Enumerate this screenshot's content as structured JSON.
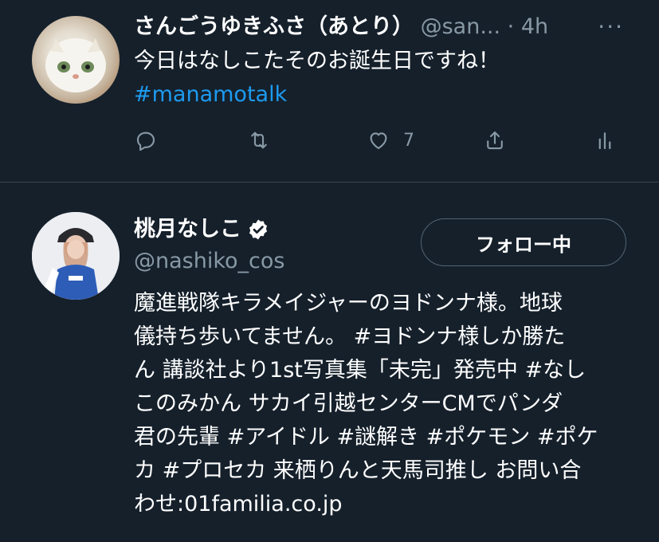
{
  "tweet": {
    "display_name": "さんごうゆきふさ（あとり）",
    "handle": "@san...",
    "time": "· 4h",
    "more": "···",
    "text_line1": "今日はなしこたそのお誕生日ですね！",
    "hashtag": "#manamotalk",
    "like_count": "7",
    "icons": [
      "reply-icon",
      "retweet-icon",
      "like-icon",
      "share-icon",
      "analytics-icon"
    ]
  },
  "profile": {
    "display_name": "桃月なしこ",
    "handle": "@nashiko_cos",
    "follow_label": "フォロー中",
    "bio_lines": [
      "魔進戦隊キラメイジャーのヨドンナ様。地球",
      "儀持ち歩いてません。 #ヨドンナ様しか勝た",
      "ん 講談社より1st写真集「未完」発売中 #なし",
      "このみかん サカイ引越センターCMでパンダ",
      "君の先輩 #アイドル #謎解き #ポケモン #ポケ",
      "カ #プロセカ 来栖りんと天馬司推し お問い合",
      "わせ:01familia.co.jp"
    ]
  },
  "colors": {
    "background": "#15202b",
    "text": "#ffffff",
    "secondary": "#8899a6",
    "link": "#1d9bf0",
    "divider": "#38444d"
  }
}
